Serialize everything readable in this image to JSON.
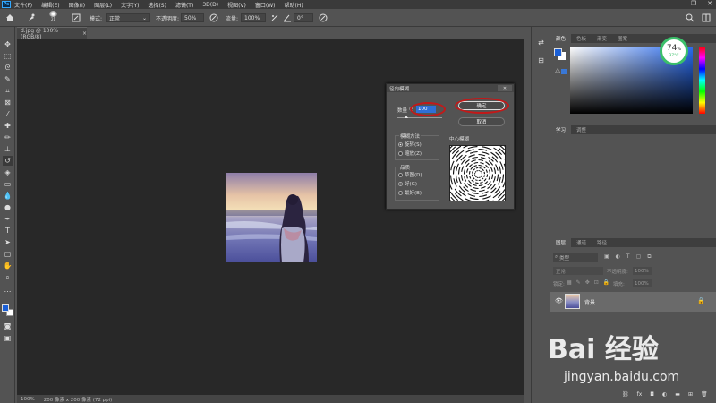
{
  "menubar": {
    "logo": "Ps",
    "items": [
      "文件(F)",
      "编辑(E)",
      "图像(I)",
      "图层(L)",
      "文字(Y)",
      "选择(S)",
      "滤镜(T)",
      "3D(D)",
      "视图(V)",
      "窗口(W)",
      "帮助(H)"
    ],
    "window_controls": [
      "—",
      "❐",
      "✕"
    ]
  },
  "options_bar": {
    "brush_size": "21",
    "mode_label": "模式:",
    "mode_value": "正常",
    "opacity_label": "不透明度:",
    "opacity_value": "50%",
    "flow_label": "流量:",
    "flow_value": "100%",
    "angle_value": "0°"
  },
  "document": {
    "tab_title": "d.jpg @ 100%(RGB/8)",
    "tab_close": "×",
    "status_zoom": "100%",
    "status_info": "200 像素 x 200 像素 (72 ppi)"
  },
  "dialog": {
    "title": "径向模糊",
    "close": "✕",
    "amount_label": "数量",
    "amount_value": "100",
    "ok_label": "确定",
    "cancel_label": "取消",
    "method_group": "模糊方法",
    "method_spin": "旋转(S)",
    "method_zoom": "缩放(Z)",
    "quality_group": "品质",
    "quality_draft": "草图(D)",
    "quality_good": "好(G)",
    "quality_best": "最好(B)",
    "center_label": "中心模糊"
  },
  "panels": {
    "color_tabs": [
      "颜色",
      "色板",
      "渐变",
      "图案"
    ],
    "learn_tabs": [
      "学习",
      "调整"
    ],
    "layers_tabs": [
      "图层",
      "通道",
      "路径"
    ],
    "search_kind": "类型",
    "blend_mode": "正常",
    "opacity_label": "不透明度:",
    "opacity_value": "100%",
    "lock_label": "锁定:",
    "fill_label": "填充:",
    "fill_value": "100%",
    "layer_name": "背景"
  },
  "badge": {
    "percent": "74",
    "unit": "%",
    "temp": "37°C"
  },
  "watermark": {
    "brand": "Bai 经验",
    "url": "jingyan.baidu.com"
  },
  "colors": {
    "foreground": "#1a5fd6",
    "background": "#ffffff",
    "accent_red": "#c41818"
  }
}
